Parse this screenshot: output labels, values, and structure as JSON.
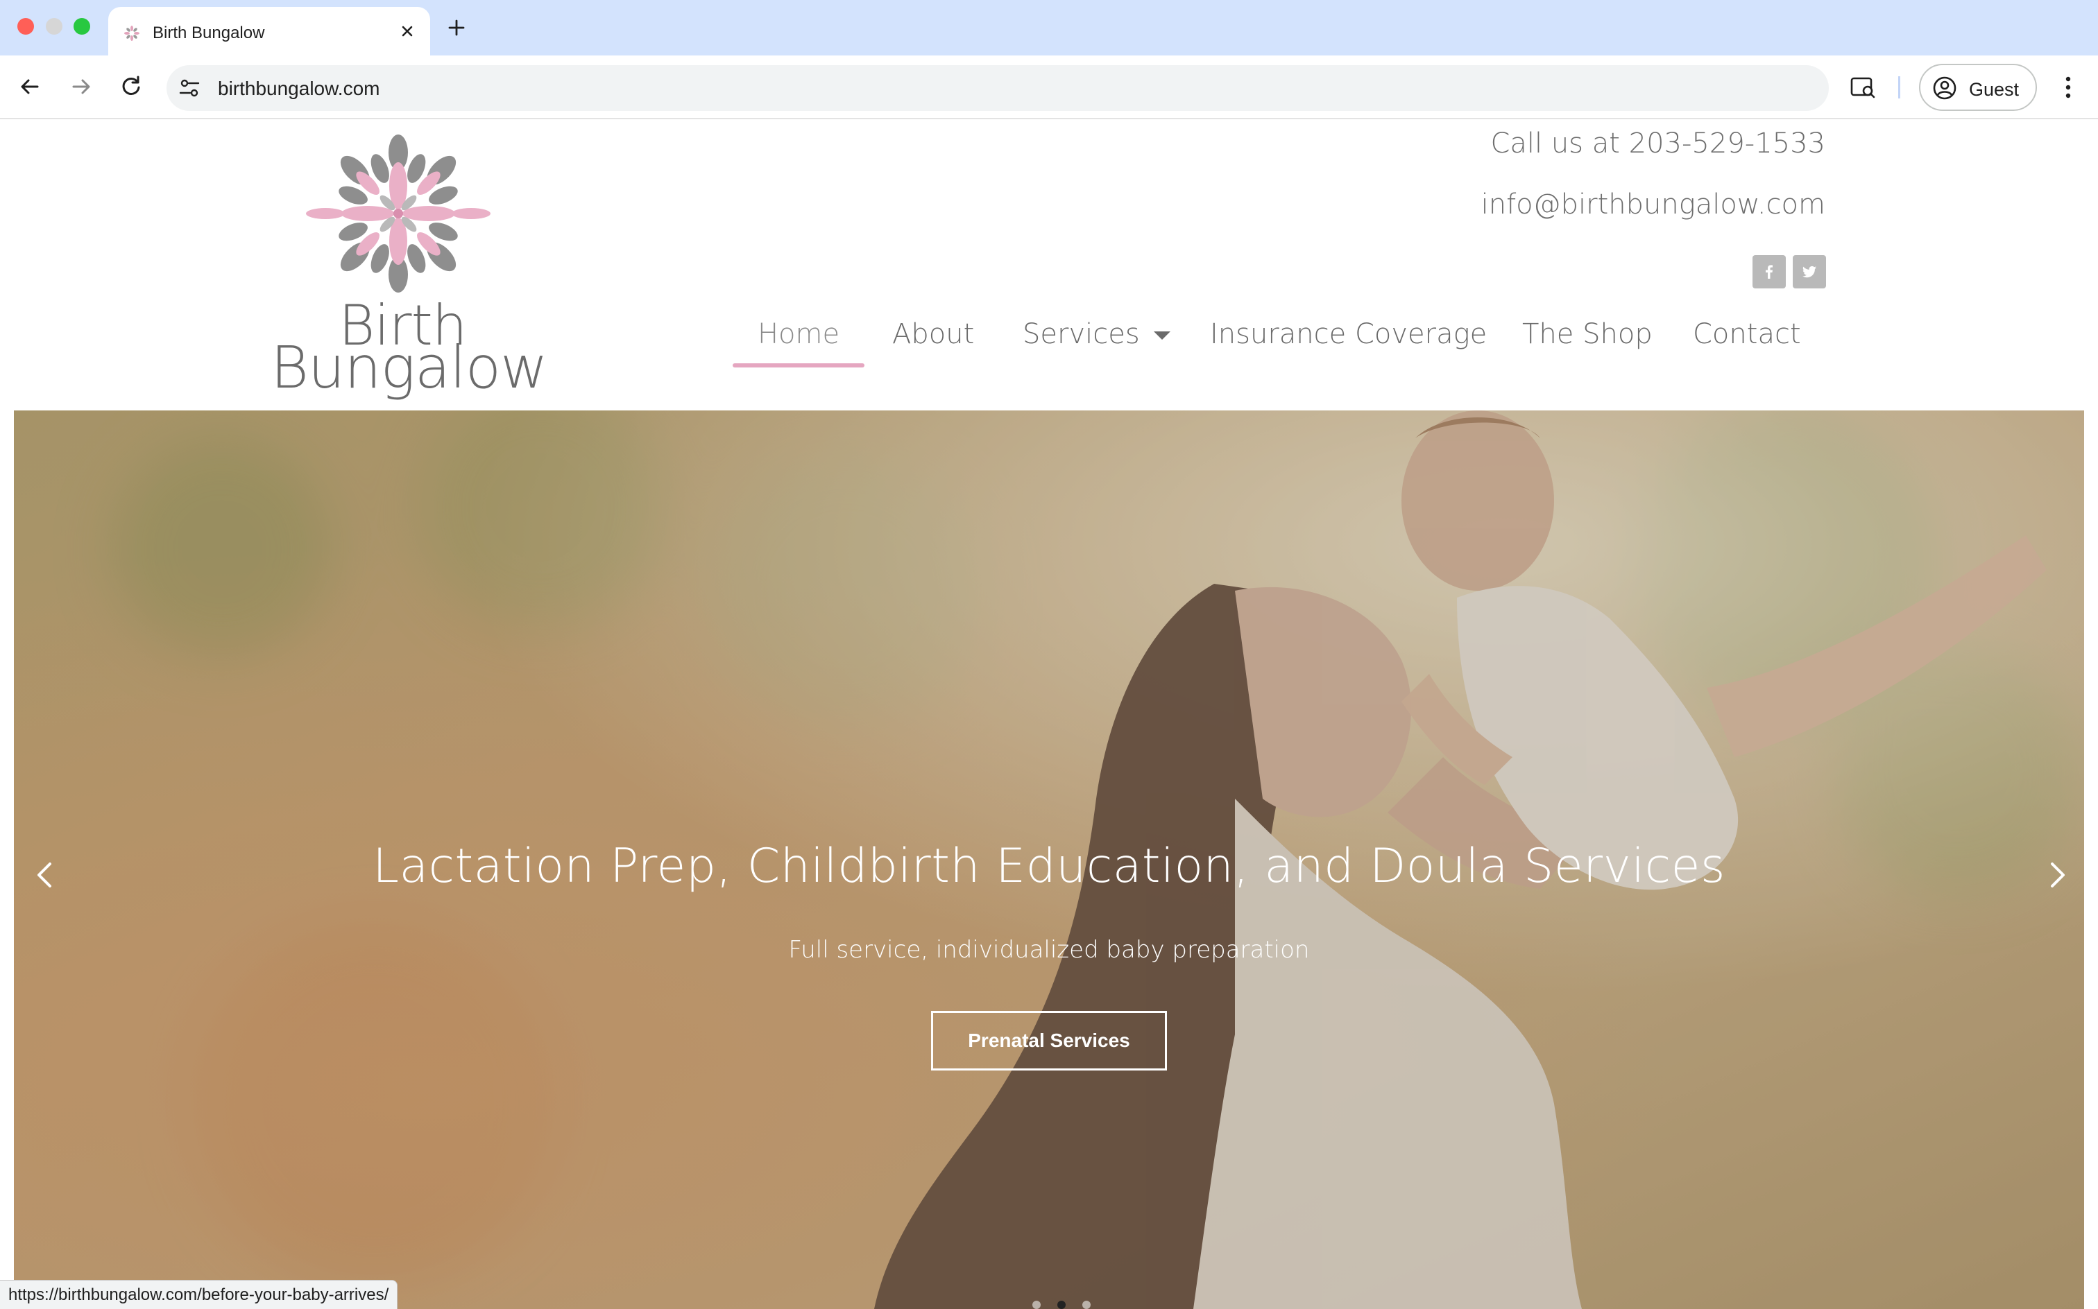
{
  "browser": {
    "tab_title": "Birth Bungalow",
    "url": "birthbungalow.com",
    "profile_label": "Guest",
    "status_url": "https://birthbungalow.com/before-your-baby-arrives/"
  },
  "header": {
    "logo_line1": "Birth",
    "logo_line2": "Bungalow",
    "phone_text": "Call us at 203-529-1533",
    "email_text": "info@birthbungalow.com",
    "social_icons": [
      "facebook-icon",
      "twitter-icon"
    ]
  },
  "nav": {
    "items": [
      {
        "label": "Home",
        "active": true
      },
      {
        "label": "About"
      },
      {
        "label": "Services",
        "has_dropdown": true
      },
      {
        "label": "Insurance Coverage"
      },
      {
        "label": "The Shop"
      },
      {
        "label": "Contact"
      }
    ],
    "accent_color": "#e5a6c0"
  },
  "hero": {
    "heading": "Lactation Prep, Childbirth Education, and Doula Services",
    "subheading": "Full service, individualized baby preparation",
    "cta_label": "Prenatal Services",
    "slide_count": 3,
    "active_slide": 2
  }
}
